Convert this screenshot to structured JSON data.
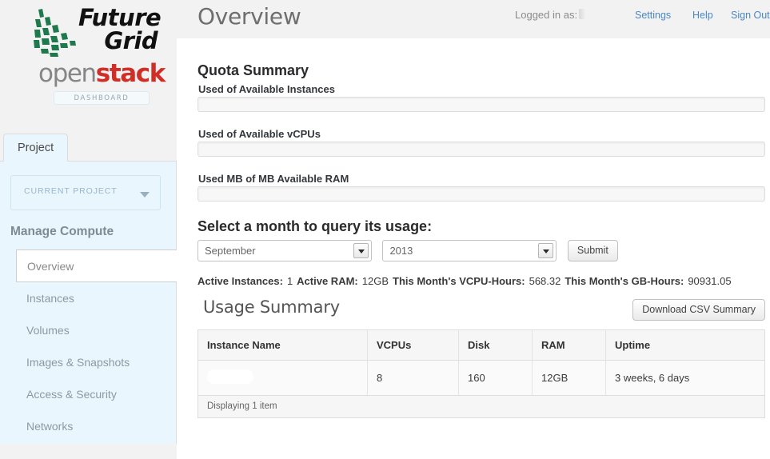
{
  "branding": {
    "future": "Future",
    "grid": "Grid",
    "openstack_open": "open",
    "openstack_stack": "stack",
    "dashboard_badge": "DASHBOARD",
    "accent_red": "#cf2f26",
    "accent_green": "#1e7a4c",
    "link_blue": "#4b87c4"
  },
  "sidebar": {
    "tab_label": "Project",
    "current_project_label": "CURRENT PROJECT",
    "chevron_icon": "chevron-down-icon",
    "section_heading": "Manage Compute",
    "items": [
      {
        "label": "Overview",
        "active": true
      },
      {
        "label": "Instances",
        "active": false
      },
      {
        "label": "Volumes",
        "active": false
      },
      {
        "label": "Images & Snapshots",
        "active": false
      },
      {
        "label": "Access & Security",
        "active": false
      },
      {
        "label": "Networks",
        "active": false
      }
    ]
  },
  "header": {
    "title": "Overview",
    "logged_in_as_label": "Logged in as:",
    "logged_in_user": "",
    "links": [
      {
        "label": "Settings"
      },
      {
        "label": "Help"
      },
      {
        "label": "Sign Out"
      }
    ]
  },
  "quota": {
    "heading": "Quota Summary",
    "bars": [
      {
        "label": "Used of Available Instances",
        "percent": 0
      },
      {
        "label": "Used of Available vCPUs",
        "percent": 0
      },
      {
        "label": "Used MB of MB Available RAM",
        "percent": 0
      }
    ]
  },
  "month_query": {
    "heading": "Select a month to query its usage:",
    "month_value": "September",
    "year_value": "2013",
    "submit_label": "Submit"
  },
  "stats": {
    "active_instances_label": "Active Instances:",
    "active_instances_value": "1",
    "active_ram_label": "Active RAM:",
    "active_ram_value": "12GB",
    "vcpu_hours_label": "This Month's VCPU-Hours:",
    "vcpu_hours_value": "568.32",
    "gb_hours_label": "This Month's GB-Hours:",
    "gb_hours_value": "90931.05"
  },
  "usage": {
    "heading": "Usage Summary",
    "csv_button_label": "Download CSV Summary",
    "columns": [
      "Instance Name",
      "VCPUs",
      "Disk",
      "RAM",
      "Uptime"
    ],
    "rows": [
      {
        "name": "",
        "vcpus": "8",
        "disk": "160",
        "ram": "12GB",
        "uptime": "3 weeks, 6 days"
      }
    ],
    "footer": "Displaying 1 item"
  }
}
